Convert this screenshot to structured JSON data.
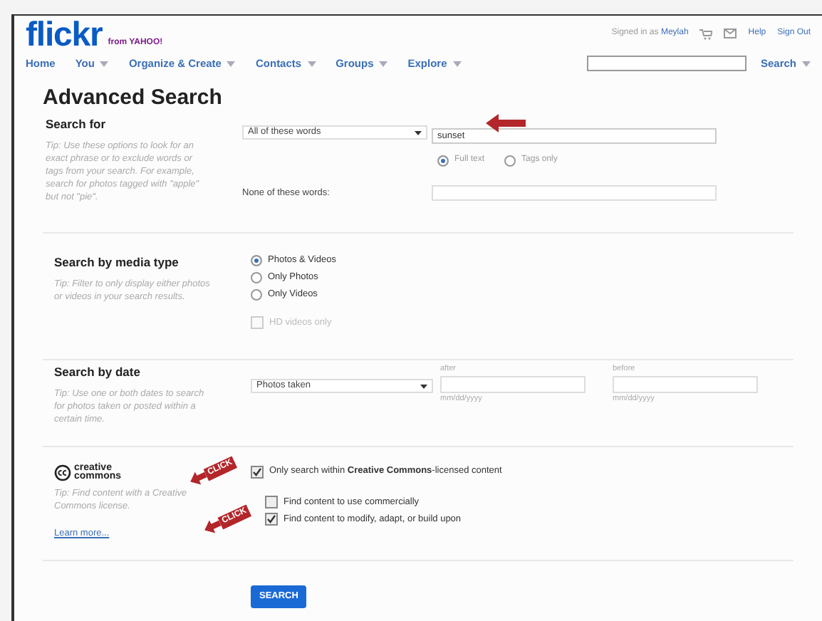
{
  "header": {
    "logo": "flickr",
    "logo_sub": "from YAHOO!",
    "signed_in": "Signed in as",
    "user": "Meylah",
    "links": [
      "Help",
      "Sign Out"
    ],
    "nav": [
      {
        "label": "Home",
        "dropdown": false
      },
      {
        "label": "You",
        "dropdown": true
      },
      {
        "label": "Organize & Create",
        "dropdown": true
      },
      {
        "label": "Contacts",
        "dropdown": true
      },
      {
        "label": "Groups",
        "dropdown": true
      },
      {
        "label": "Explore",
        "dropdown": true
      }
    ],
    "search_button": "Search"
  },
  "title": "Advanced Search",
  "search_for": {
    "heading": "Search for",
    "tip": "Tip: Use these options to look for an exact phrase or to exclude words or tags from your search. For example, search for photos tagged with \"apple\" but not \"pie\".",
    "mode": "All of these words",
    "value": "sunset",
    "scope": [
      {
        "label": "Full text",
        "selected": true
      },
      {
        "label": "Tags only",
        "selected": false
      }
    ],
    "none_label": "None of these words:"
  },
  "media": {
    "heading": "Search by media type",
    "tip": "Tip: Filter to only display either photos or videos in your search results.",
    "options": [
      {
        "label": "Photos & Videos",
        "selected": true
      },
      {
        "label": "Only Photos",
        "selected": false
      },
      {
        "label": "Only Videos",
        "selected": false
      }
    ],
    "hd": {
      "label": "HD videos only",
      "checked": false,
      "disabled": true
    }
  },
  "date": {
    "heading": "Search by date",
    "tip": "Tip: Use one or both dates to search for photos taken or posted within a certain time.",
    "mode": "Photos taken",
    "fields": [
      {
        "label": "after",
        "placeholder": "mm/dd/yyyy"
      },
      {
        "label": "before",
        "placeholder": "mm/dd/yyyy"
      }
    ]
  },
  "cc": {
    "logo_top": "creative",
    "logo_bottom": "commons",
    "tip": "Tip: Find content with a Creative Commons license.",
    "learn_more": "Learn more...",
    "options": [
      {
        "label": "Only search within **Creative Commons**-licensed content",
        "checked": true,
        "callout": "CLICK"
      },
      {
        "label": "Find content to use commercially",
        "checked": false
      },
      {
        "label": "Find content to modify, adapt, or build upon",
        "checked": true,
        "callout": "CLICK"
      }
    ]
  },
  "submit": "SEARCH"
}
